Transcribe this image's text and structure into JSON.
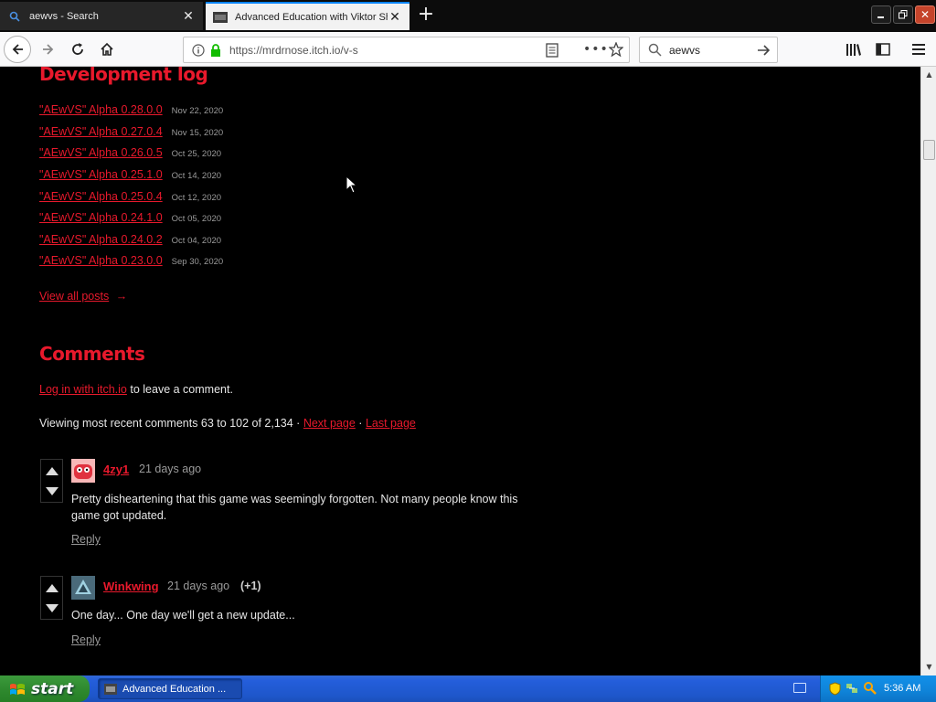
{
  "tabs": [
    {
      "title": "aewvs - Search",
      "favicon": "search-favicon"
    },
    {
      "title": "Advanced Education with Viktor Sh",
      "favicon": "page-favicon"
    }
  ],
  "navbar": {
    "url": "https://mrdrnose.itch.io/v-s",
    "search_value": "aewvs"
  },
  "devlog": {
    "heading": "Development log",
    "posts": [
      {
        "title": "\"AEwVS\" Alpha 0.28.0.0",
        "date": "Nov 22, 2020"
      },
      {
        "title": "\"AEwVS\" Alpha 0.27.0.4",
        "date": "Nov 15, 2020"
      },
      {
        "title": "\"AEwVS\" Alpha 0.26.0.5",
        "date": "Oct 25, 2020"
      },
      {
        "title": "\"AEwVS\" Alpha 0.25.1.0",
        "date": "Oct 14, 2020"
      },
      {
        "title": "\"AEwVS\" Alpha 0.25.0.4",
        "date": "Oct 12, 2020"
      },
      {
        "title": "\"AEwVS\" Alpha 0.24.1.0",
        "date": "Oct 05, 2020"
      },
      {
        "title": "\"AEwVS\" Alpha 0.24.0.2",
        "date": "Oct 04, 2020"
      },
      {
        "title": "\"AEwVS\" Alpha 0.23.0.0",
        "date": "Sep 30, 2020"
      }
    ],
    "view_all": "View all posts"
  },
  "comments": {
    "heading": "Comments",
    "login_link": "Log in with itch.io",
    "login_suffix": "to leave a comment.",
    "viewing_text": "Viewing most recent comments 63 to 102 of 2,134 ·",
    "next_page": "Next page",
    "separator": "·",
    "last_page": "Last page",
    "items": [
      {
        "user": "4zy1",
        "time": "21 days ago",
        "votes": "",
        "body": "Pretty disheartening that this game was seemingly forgotten. Not many people know this game got updated.",
        "reply": "Reply"
      },
      {
        "user": "Winkwing",
        "time": "21 days ago",
        "votes": "(+1)",
        "body": "One day... One day we'll get a new update...",
        "reply": "Reply"
      }
    ]
  },
  "taskbar": {
    "start_label": "start",
    "task_label": "Advanced Education ...",
    "clock": "5:36 AM"
  },
  "colors": {
    "accent": "#e8192c",
    "page_bg": "#000000",
    "taskbar": "#245edb",
    "start": "#2f8a2f"
  }
}
